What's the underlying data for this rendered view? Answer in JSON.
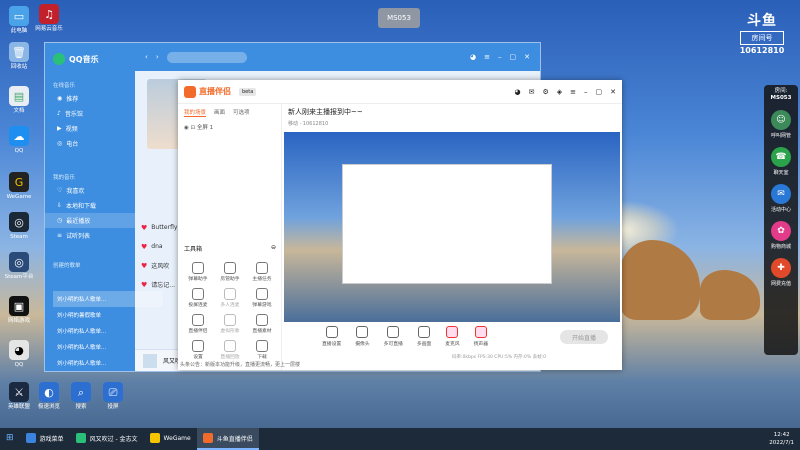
{
  "overlay_label": "MS053",
  "douyu": {
    "logo": "斗鱼",
    "room_box": "房间号",
    "room_number": "10612810"
  },
  "right_panel": {
    "room_label": "房间:",
    "room_value": "MS053",
    "items": [
      "呼叫网管",
      "聊天室",
      "活动中心",
      "购物商城",
      "网费充值"
    ]
  },
  "desktop_icons": [
    "此电脑",
    "网易云音乐",
    "回收站",
    "文档",
    "QQ",
    "WeGame",
    "Steam",
    "Steam平台",
    "网络游戏",
    "游戏中心",
    "QQ"
  ],
  "desktop_bottom_icons": [
    "英雄联盟",
    "极速浏览",
    "搜索",
    "投屏"
  ],
  "qq_music": {
    "title": "QQ音乐",
    "section_online": "在线音乐",
    "nav": [
      "推荐",
      "音乐馆",
      "视频",
      "电台"
    ],
    "section_my": "我的音乐",
    "my_items": [
      "我喜欢",
      "本地和下载",
      "最近播放",
      "试听列表"
    ],
    "section_created": "创建的歌单",
    "songs": [
      "Butterfly",
      "dna",
      "这风吹",
      "请忘记..."
    ],
    "history": [
      "刘小明的私人歌单...",
      "刘小明的暑假歌单",
      "刘小明的私人歌单...",
      "刘小明的私人歌单...",
      "刘小明的私人歌单..."
    ],
    "bottom_song": "风又吹过"
  },
  "live_app": {
    "brand": "直播伴侣",
    "version": "beta",
    "room_title": "新人刚来主播报到中~~",
    "room_tag": "移动",
    "room_id": "10612810",
    "tabs": [
      "我的场景",
      "画面",
      "可选项"
    ],
    "scene": "全屏 1",
    "tools_title": "工具箱",
    "tools": [
      "弹幕助手",
      "房管助手",
      "主播任务",
      "投屏连麦",
      "多人连麦",
      "弹幕游戏",
      "直播伴侣",
      "虚拟形象",
      "直播素材",
      "设置",
      "直播回放",
      "下载"
    ],
    "controls": [
      "直播设置",
      "摄像头",
      "多可直播",
      "多画面",
      "麦克风",
      "扬声器"
    ],
    "start": "开始直播",
    "stats": "码率:0kbps  FPS:30  CPU:5%  内存:0%  丢帧:0",
    "notice": "头条公告：新版本功能升级，直播更流畅，更上一层楼"
  },
  "taskbar": {
    "items": [
      "游戏菜单",
      "风又吹过 - 金志文",
      "WeGame",
      "斗鱼直播伴侣"
    ],
    "time": "12:42",
    "date": "2022/7/1"
  }
}
